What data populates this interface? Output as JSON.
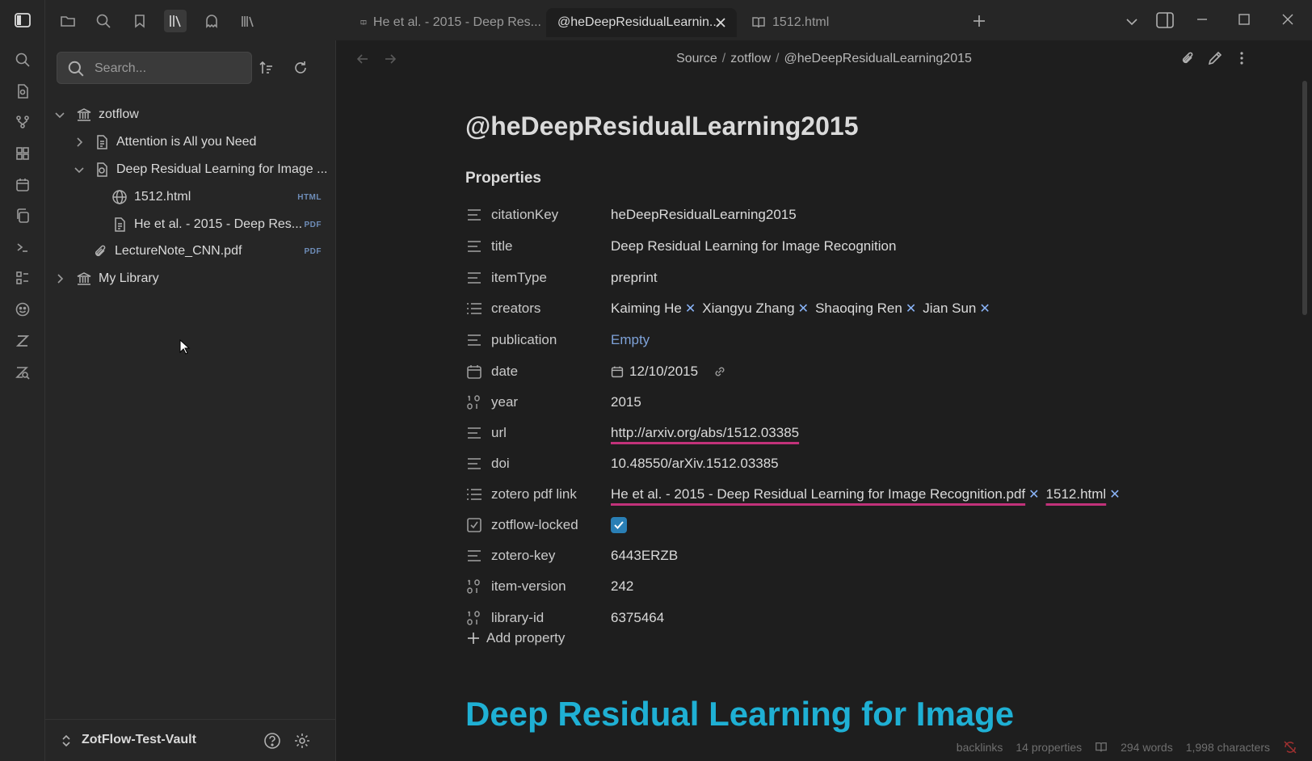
{
  "tabs": [
    {
      "label": "He et al. - 2015 - Deep Res...",
      "active": false
    },
    {
      "label": "@heDeepResidualLearnin...",
      "active": true
    },
    {
      "label": "1512.html",
      "active": false
    }
  ],
  "sidebar": {
    "search_placeholder": "Search...",
    "tree": [
      {
        "label": "zotflow"
      },
      {
        "label": "Attention is All you Need"
      },
      {
        "label": "Deep Residual Learning for Image ..."
      },
      {
        "label": "1512.html",
        "badge": "HTML"
      },
      {
        "label": "He et al. - 2015 - Deep Res...",
        "badge": "PDF"
      },
      {
        "label": "LectureNote_CNN.pdf",
        "badge": "PDF"
      },
      {
        "label": "My Library"
      }
    ],
    "vault_name": "ZotFlow-Test-Vault"
  },
  "breadcrumb": {
    "part1": "Source",
    "part2": "zotflow",
    "part3": "@heDeepResidualLearning2015",
    "separator": "/"
  },
  "note": {
    "title": "@heDeepResidualLearning2015",
    "properties_heading": "Properties",
    "properties": [
      {
        "key": "citationKey",
        "value": "heDeepResidualLearning2015"
      },
      {
        "key": "title",
        "value": "Deep Residual Learning for Image Recognition"
      },
      {
        "key": "itemType",
        "value": "preprint"
      },
      {
        "key": "creators",
        "values": [
          "Kaiming He",
          "Xiangyu Zhang",
          "Shaoqing Ren",
          "Jian Sun"
        ]
      },
      {
        "key": "publication",
        "value": "Empty"
      },
      {
        "key": "date",
        "value": "12/10/2015"
      },
      {
        "key": "year",
        "value": "2015"
      },
      {
        "key": "url",
        "value": "http://arxiv.org/abs/1512.03385"
      },
      {
        "key": "doi",
        "value": "10.48550/arXiv.1512.03385"
      },
      {
        "key": "zotero pdf link",
        "values": [
          "He et al. - 2015 - Deep Residual Learning for Image Recognition.pdf",
          "1512.html"
        ]
      },
      {
        "key": "zotflow-locked",
        "checked": true
      },
      {
        "key": "zotero-key",
        "value": "6443ERZB"
      },
      {
        "key": "item-version",
        "value": "242"
      },
      {
        "key": "library-id",
        "value": "6375464"
      }
    ],
    "add_property_label": "Add property",
    "body_heading": "Deep Residual Learning for Image"
  },
  "status": {
    "backlinks": "backlinks",
    "properties": "14 properties",
    "words": "294 words",
    "characters": "1,998 characters"
  },
  "colors": {
    "accent": "#2a7fb5",
    "heading_cyan": "#1fb0d4",
    "link_underline": "#c2327a"
  }
}
